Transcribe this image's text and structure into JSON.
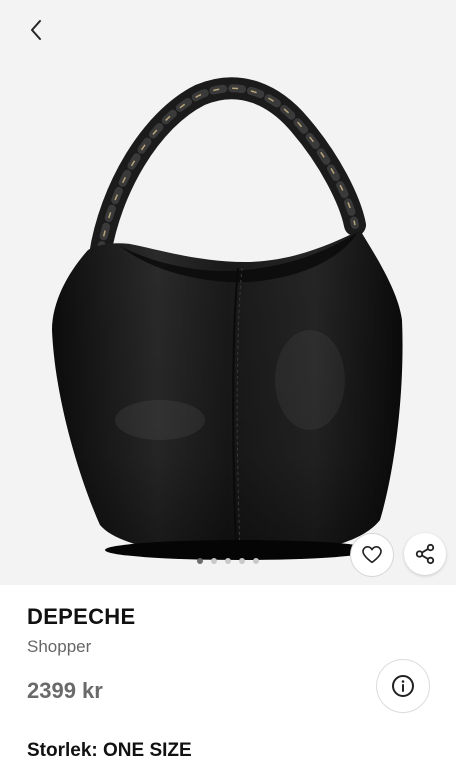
{
  "product": {
    "brand": "DEPECHE",
    "type": "Shopper",
    "price": "2399 kr",
    "size_label": "Storlek: ONE SIZE"
  },
  "gallery": {
    "image_count": 5,
    "active_index": 0,
    "background": "#f3f3f3"
  },
  "icons": {
    "back": "chevron-left-icon",
    "favorite": "heart-icon",
    "share": "share-icon",
    "info": "info-icon"
  }
}
